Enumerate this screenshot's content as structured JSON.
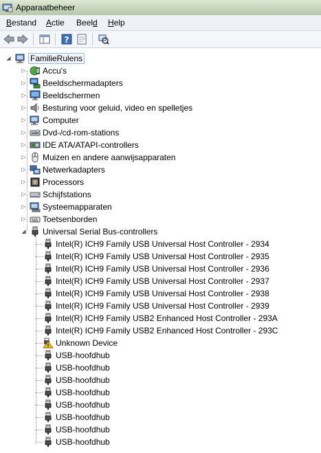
{
  "window": {
    "title": "Apparaatbeheer"
  },
  "menu": [
    {
      "label": "Bestand",
      "u": "B",
      "rest": "estand"
    },
    {
      "label": "Actie",
      "u": "A",
      "rest": "ctie"
    },
    {
      "label": "Beeld",
      "pre": "Beel",
      "u": "d",
      "rest": ""
    },
    {
      "label": "Help",
      "u": "H",
      "rest": "elp"
    }
  ],
  "toolbar": [
    "back-icon",
    "forward-icon",
    "console-tree-icon",
    "help-icon",
    "properties-icon",
    "scan-hardware-icon"
  ],
  "tree": {
    "root": {
      "label": "FamilieRulens",
      "icon": "computer-icon"
    },
    "categories": [
      {
        "label": "Accu's",
        "icon": "battery-icon"
      },
      {
        "label": "Beeldschermadapters",
        "icon": "display-adapter-icon"
      },
      {
        "label": "Beeldschermen",
        "icon": "monitor-icon"
      },
      {
        "label": "Besturing voor geluid, video en spelletjes",
        "icon": "speaker-icon"
      },
      {
        "label": "Computer",
        "icon": "computer-icon"
      },
      {
        "label": "Dvd-/cd-rom-stations",
        "icon": "dvd-drive-icon"
      },
      {
        "label": "IDE ATA/ATAPI-controllers",
        "icon": "ide-controller-icon"
      },
      {
        "label": "Muizen en andere aanwijsapparaten",
        "icon": "mouse-icon"
      },
      {
        "label": "Netwerkadapters",
        "icon": "network-icon"
      },
      {
        "label": "Processors",
        "icon": "processor-icon"
      },
      {
        "label": "Schijfstations",
        "icon": "disk-drive-icon"
      },
      {
        "label": "Systeemapparaten",
        "icon": "system-device-icon"
      },
      {
        "label": "Toetsenborden",
        "icon": "keyboard-icon"
      }
    ],
    "usb": {
      "label": "Universal Serial Bus-controllers",
      "icon": "usb-icon",
      "children": [
        {
          "label": "Intel(R) ICH9 Family USB Universal Host Controller - 2934",
          "icon": "usb-icon"
        },
        {
          "label": "Intel(R) ICH9 Family USB Universal Host Controller - 2935",
          "icon": "usb-icon"
        },
        {
          "label": "Intel(R) ICH9 Family USB Universal Host Controller - 2936",
          "icon": "usb-icon"
        },
        {
          "label": "Intel(R) ICH9 Family USB Universal Host Controller - 2937",
          "icon": "usb-icon"
        },
        {
          "label": "Intel(R) ICH9 Family USB Universal Host Controller - 2938",
          "icon": "usb-icon"
        },
        {
          "label": "Intel(R) ICH9 Family USB Universal Host Controller - 2939",
          "icon": "usb-icon"
        },
        {
          "label": "Intel(R) ICH9 Family USB2 Enhanced Host Controller - 293A",
          "icon": "usb-icon"
        },
        {
          "label": "Intel(R) ICH9 Family USB2 Enhanced Host Controller - 293C",
          "icon": "usb-icon"
        },
        {
          "label": "Unknown Device",
          "icon": "warning-icon"
        },
        {
          "label": "USB-hoofdhub",
          "icon": "usb-icon"
        },
        {
          "label": "USB-hoofdhub",
          "icon": "usb-icon"
        },
        {
          "label": "USB-hoofdhub",
          "icon": "usb-icon"
        },
        {
          "label": "USB-hoofdhub",
          "icon": "usb-icon"
        },
        {
          "label": "USB-hoofdhub",
          "icon": "usb-icon"
        },
        {
          "label": "USB-hoofdhub",
          "icon": "usb-icon"
        },
        {
          "label": "USB-hoofdhub",
          "icon": "usb-icon"
        },
        {
          "label": "USB-hoofdhub",
          "icon": "usb-icon"
        }
      ]
    }
  }
}
